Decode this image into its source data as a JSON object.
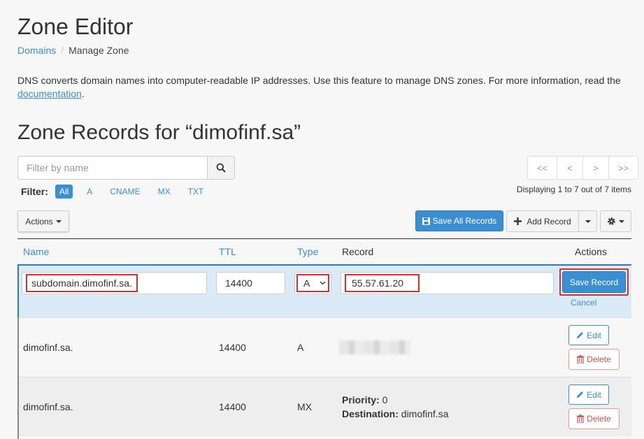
{
  "page": {
    "title": "Zone Editor",
    "breadcrumb": {
      "root": "Domains",
      "current": "Manage Zone"
    },
    "intro_text": "DNS converts domain names into computer-readable IP addresses. Use this feature to manage DNS zones. For more information, read the ",
    "intro_link": "documentation",
    "intro_end": ".",
    "section_title": "Zone Records for “dimofinf.sa”"
  },
  "search": {
    "placeholder": "Filter by name"
  },
  "pager": {
    "first": "<<",
    "prev": "<",
    "next": ">",
    "last": ">>"
  },
  "filter": {
    "label": "Filter:",
    "options": [
      "All",
      "A",
      "CNAME",
      "MX",
      "TXT"
    ],
    "active": "All"
  },
  "displaying": "Displaying 1 to 7 out of 7 items",
  "toolbar": {
    "actions": "Actions",
    "save_all": "Save All Records",
    "add_record": "Add Record"
  },
  "table": {
    "headers": {
      "name": "Name",
      "ttl": "TTL",
      "type": "Type",
      "record": "Record",
      "actions": "Actions"
    },
    "edit_row": {
      "name": "subdomain.dimofinf.sa.",
      "ttl": "14400",
      "type": "A",
      "record": "55.57.61.20",
      "save": "Save Record",
      "cancel": "Cancel"
    },
    "rows": [
      {
        "name": "dimofinf.sa.",
        "ttl": "14400",
        "type": "A",
        "record": "",
        "edit": "Edit",
        "delete": "Delete"
      },
      {
        "name": "dimofinf.sa.",
        "ttl": "14400",
        "type": "MX",
        "priority_label": "Priority:",
        "priority": "0",
        "destination_label": "Destination:",
        "destination": "dimofinf.sa",
        "edit": "Edit",
        "delete": "Delete"
      }
    ]
  },
  "colors": {
    "accent": "#3b8fd0",
    "danger": "#d9534f",
    "highlight": "#d9302f",
    "edit_row_bg": "#daeaf7"
  }
}
